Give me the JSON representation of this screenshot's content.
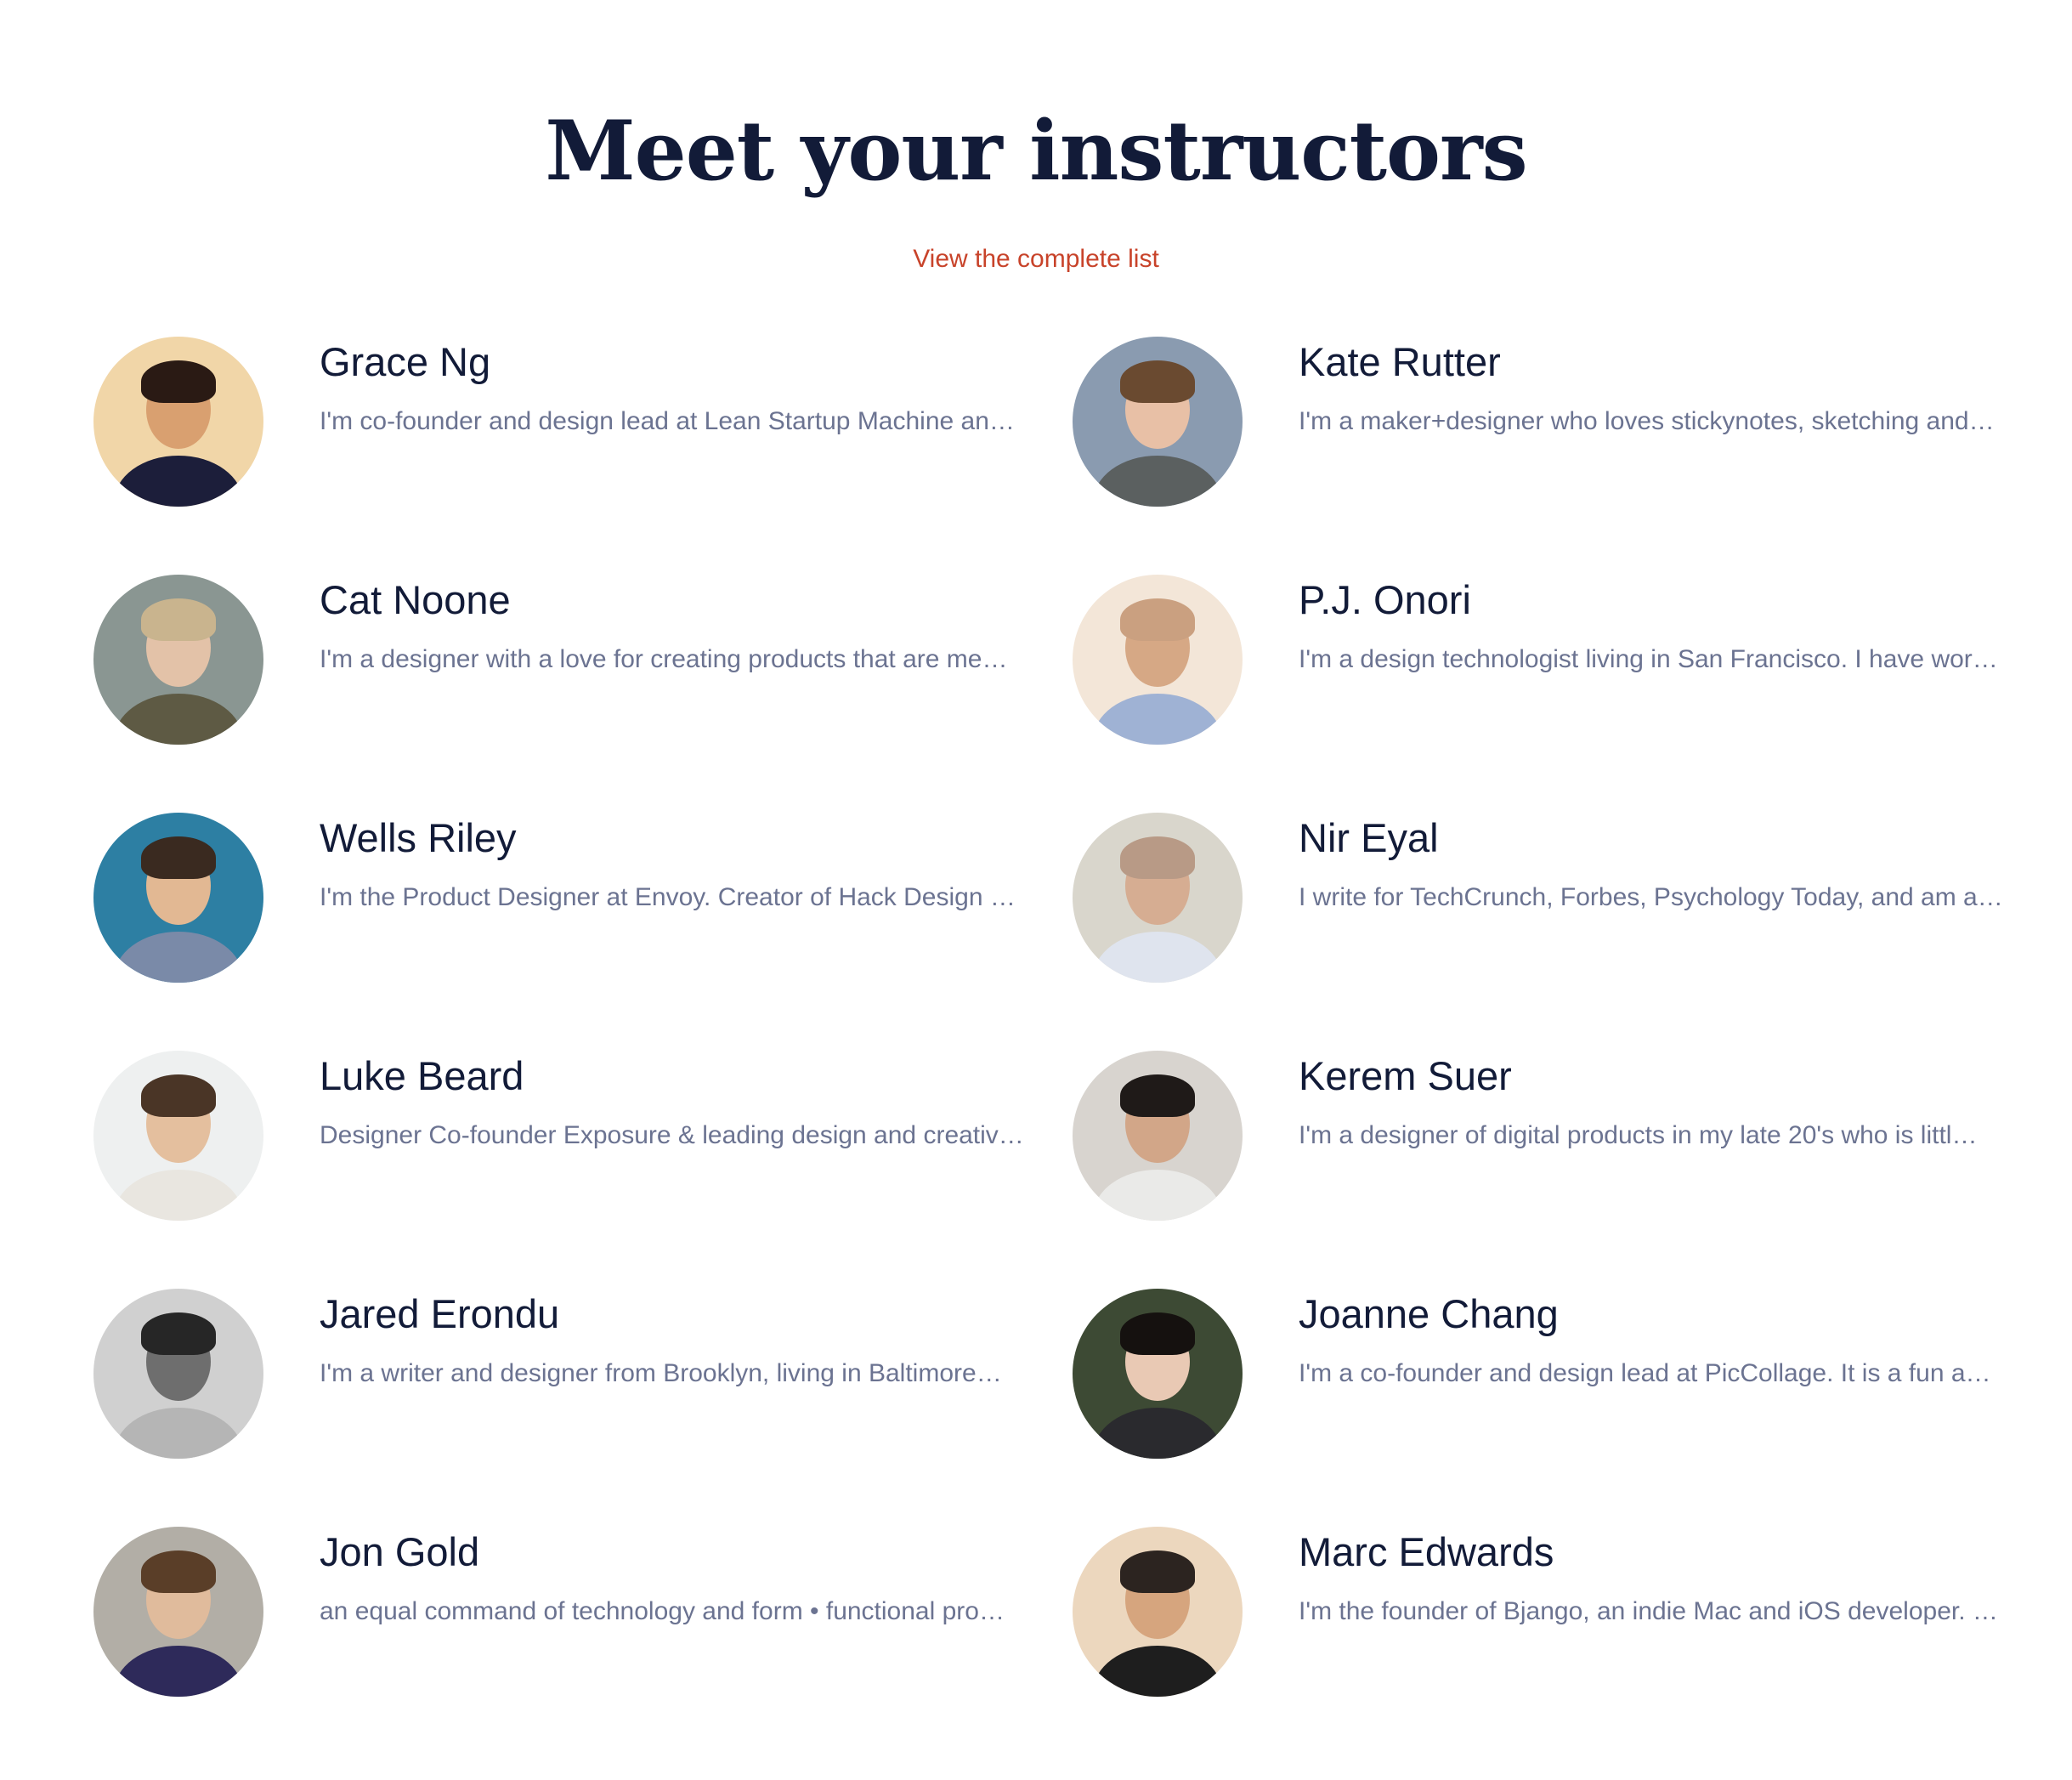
{
  "header": {
    "title": "Meet your instructors",
    "view_link": "View the complete list"
  },
  "colors": {
    "title": "#121b38",
    "link": "#c8432a",
    "bio": "#6b7391",
    "link_underline": "#d8dbe6"
  },
  "instructors": [
    {
      "name": "Grace Ng",
      "bio": "I'm co-founder and design lead at Lean Startup Machine an…",
      "avatar": {
        "bg": "#f1d6a8",
        "face": "#d9a070",
        "hair": "#2a1a14",
        "shirt": "#1c1e3a"
      }
    },
    {
      "name": "Kate Rutter",
      "bio": "I'm a maker+designer who loves stickynotes, sketching and…",
      "avatar": {
        "bg": "#8a9bb0",
        "face": "#e8c0a6",
        "hair": "#6a4a30",
        "shirt": "#5b6060"
      }
    },
    {
      "name": "Cat Noone",
      "bio": "I'm a designer with a love for creating products that are me…",
      "avatar": {
        "bg": "#8a9692",
        "face": "#e3c2a8",
        "hair": "#c9b48e",
        "shirt": "#5e5a44"
      }
    },
    {
      "name": "P.J. Onori",
      "bio": "I'm a design technologist living in San Francisco. I have wor…",
      "avatar": {
        "bg": "#f3e6d8",
        "face": "#d6a885",
        "hair": "#caa080",
        "shirt": "#9fb2d4"
      }
    },
    {
      "name": "Wells Riley",
      "bio": "I'm the Product Designer at Envoy. Creator of Hack Design …",
      "avatar": {
        "bg": "#2d7fa3",
        "face": "#e2b893",
        "hair": "#3a2a20",
        "shirt": "#7a8aa8"
      }
    },
    {
      "name": "Nir Eyal",
      "bio": "I write for TechCrunch, Forbes, Psychology Today, and am a…",
      "avatar": {
        "bg": "#d9d6cc",
        "face": "#d6ad92",
        "hair": "#b89a86",
        "shirt": "#dfe4ee"
      }
    },
    {
      "name": "Luke Beard",
      "bio": "Designer Co-founder Exposure & leading design and creativ…",
      "avatar": {
        "bg": "#eef0f0",
        "face": "#e4bf9e",
        "hair": "#4a3526",
        "shirt": "#e9e6e0"
      }
    },
    {
      "name": "Kerem Suer",
      "bio": "I'm a designer of digital products in my late 20's who is littl…",
      "avatar": {
        "bg": "#d8d4cf",
        "face": "#d2a688",
        "hair": "#1f1a18",
        "shirt": "#eaeae8"
      }
    },
    {
      "name": "Jared Erondu",
      "bio": "I'm a writer and designer from Brooklyn, living in Baltimore…",
      "avatar": {
        "bg": "#d0d0d0",
        "face": "#6e6e6e",
        "hair": "#262626",
        "shirt": "#b5b5b5"
      }
    },
    {
      "name": "Joanne Chang",
      "bio": "I'm a co-founder and design lead at PicCollage. It is a fun a…",
      "avatar": {
        "bg": "#3d4a34",
        "face": "#e9c9b4",
        "hair": "#15110f",
        "shirt": "#2a2a2e"
      }
    },
    {
      "name": "Jon Gold",
      "bio": "an equal command of technology and form • functional pro…",
      "avatar": {
        "bg": "#b2aea6",
        "face": "#e0bb9c",
        "hair": "#5a3e28",
        "shirt": "#2e2a5a"
      }
    },
    {
      "name": "Marc Edwards",
      "bio": "I'm the founder of Bjango, an indie Mac and iOS developer. …",
      "avatar": {
        "bg": "#ecd7be",
        "face": "#d6a57e",
        "hair": "#2c2420",
        "shirt": "#1e1e1e"
      }
    }
  ]
}
